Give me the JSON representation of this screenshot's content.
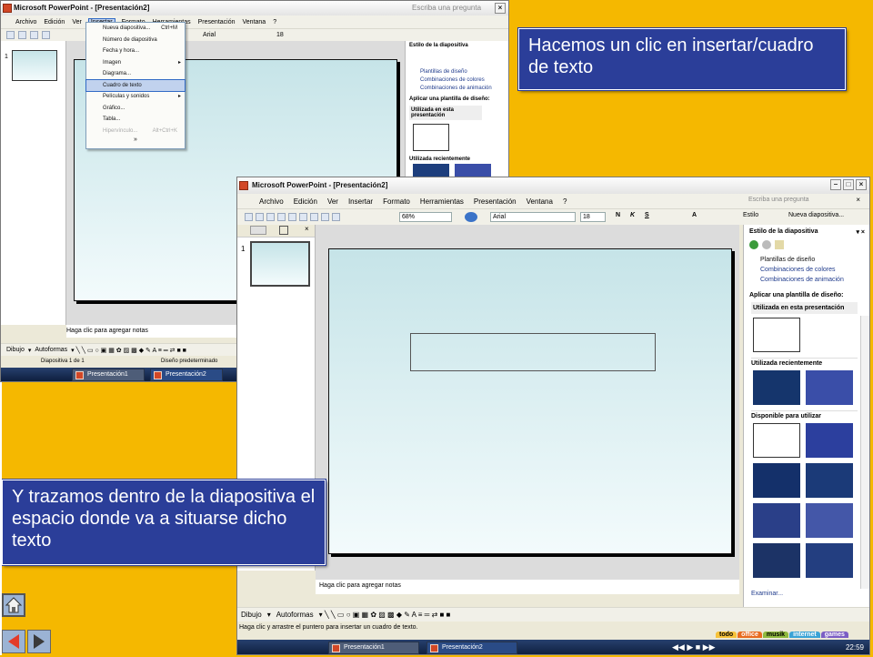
{
  "back_window": {
    "title": "Microsoft PowerPoint - [Presentación2]",
    "menu": [
      "Archivo",
      "Edición",
      "Ver",
      "Insertar",
      "Formato",
      "Herramientas",
      "Presentación",
      "Ventana",
      "?"
    ],
    "search_placeholder": "Escriba una pregunta",
    "font": "Arial",
    "font_size": "18",
    "notes_placeholder": "Haga clic para agregar notas",
    "draw_label": "Dibujo",
    "autoshapes_label": "Autoformas",
    "status_slide": "Diapositiva 1 de 1",
    "status_design": "Diseño predeterminado",
    "slide_number": "1",
    "taskpane_title": "Estilo de la diapositiva",
    "taskpane_links": [
      "Plantillas de diseño",
      "Combinaciones de colores",
      "Combinaciones de animación"
    ],
    "apply_label": "Aplicar una plantilla de diseño:",
    "used_in_presentation": "Utilizada en esta presentación",
    "recently_used": "Utilizada recientemente",
    "taskbar_items": [
      "Presentación1",
      "Presentación2"
    ]
  },
  "insert_menu": {
    "items": [
      {
        "label": "Nueva diapositiva...",
        "shortcut": "Ctrl+M",
        "state": "normal"
      },
      {
        "label": "Número de diapositiva",
        "shortcut": "",
        "state": "normal"
      },
      {
        "label": "Fecha y hora...",
        "shortcut": "",
        "state": "normal"
      },
      {
        "label": "Imagen",
        "shortcut": "",
        "state": "submenu"
      },
      {
        "label": "Diagrama...",
        "shortcut": "",
        "state": "normal"
      },
      {
        "label": "Cuadro de texto",
        "shortcut": "",
        "state": "selected"
      },
      {
        "label": "Películas y sonidos",
        "shortcut": "",
        "state": "submenu"
      },
      {
        "label": "Gráfico...",
        "shortcut": "",
        "state": "normal"
      },
      {
        "label": "Tabla...",
        "shortcut": "",
        "state": "normal"
      },
      {
        "label": "Hipervínculo...",
        "shortcut": "Alt+Ctrl+K",
        "state": "disabled"
      }
    ],
    "expand_glyph": "»"
  },
  "front_window": {
    "title": "Microsoft PowerPoint - [Presentación2]",
    "menu": [
      "Archivo",
      "Edición",
      "Ver",
      "Insertar",
      "Formato",
      "Herramientas",
      "Presentación",
      "Ventana",
      "?"
    ],
    "search_placeholder": "Escriba una pregunta",
    "zoom": "68%",
    "font": "Arial",
    "font_size": "18",
    "bold": "N",
    "italic": "K",
    "underline": "S",
    "style_button": "Estilo",
    "new_slide_button": "Nueva diapositiva...",
    "slide_number": "1",
    "notes_placeholder": "Haga clic para agregar notas",
    "draw_label": "Dibujo",
    "autoshapes_label": "Autoformas",
    "status_text": "Haga clic y arrastre el puntero para insertar un cuadro de texto.",
    "taskpane_title": "Estilo de la diapositiva",
    "taskpane_links": [
      "Plantillas de diseño",
      "Combinaciones de colores",
      "Combinaciones de animación"
    ],
    "apply_label": "Aplicar una plantilla de diseño:",
    "used_in_presentation": "Utilizada en esta presentación",
    "recently_used": "Utilizada recientemente",
    "available": "Disponible para utilizar",
    "browse_label": "Examinar...",
    "taskbar_items": [
      "Presentación1",
      "Presentación2"
    ],
    "tabs": [
      "todo",
      "office",
      "musik",
      "internet",
      "games"
    ],
    "clock": "22:59"
  },
  "callouts": {
    "top": "Hacemos un clic en insertar/cuadro de texto",
    "bottom": "Y trazamos dentro de la diapositiva el espacio donde va a situarse dicho texto"
  },
  "colors": {
    "background": "#f5b800",
    "callout": "#2b3e99",
    "menu_highlight": "#c1d2ee"
  }
}
